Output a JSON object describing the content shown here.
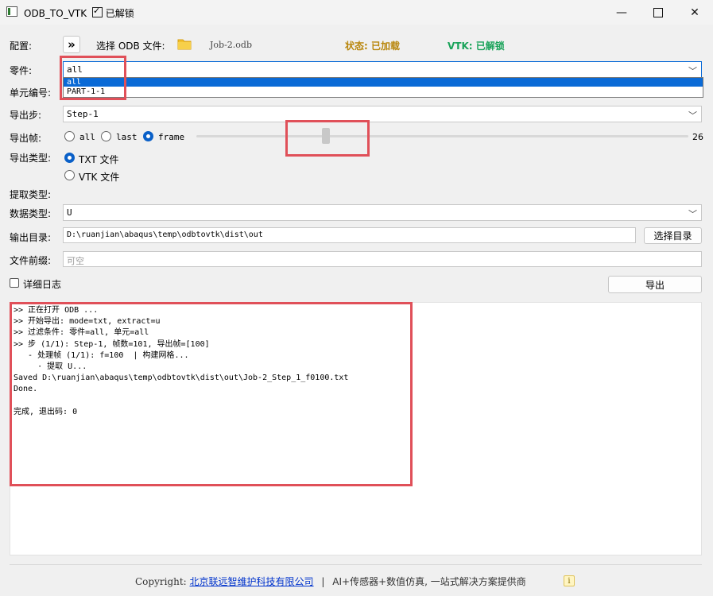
{
  "window": {
    "title": "ODB_TO_VTK",
    "title_status": "已解锁",
    "minimize_glyph": "—",
    "close_glyph": "✕"
  },
  "config": {
    "label": "配置:",
    "expand_glyph": "»",
    "select_odb_label": "选择 ODB 文件:",
    "file_name": "Job-2.odb",
    "status_text": "状态: 已加载",
    "vtk_text": "VTK: 已解锁"
  },
  "part": {
    "label": "零件:",
    "value": "all",
    "options": [
      "all",
      "PART-1-1"
    ]
  },
  "element": {
    "label": "单元编号:"
  },
  "step": {
    "label": "导出步:",
    "value": "Step-1"
  },
  "frame": {
    "label": "导出帧:",
    "options": [
      "all",
      "last",
      "frame"
    ],
    "selected": "frame",
    "slider_value": "26",
    "slider_fraction": 0.26
  },
  "export_type": {
    "label": "导出类型:",
    "options": [
      "TXT 文件",
      "VTK 文件"
    ],
    "selected": "TXT 文件"
  },
  "extract": {
    "label": "提取类型:"
  },
  "data_type": {
    "label": "数据类型:",
    "value": "U"
  },
  "output": {
    "label": "输出目录:",
    "path": "D:\\ruanjian\\abaqus\\temp\\odbtovtk\\dist\\out",
    "browse_label": "选择目录"
  },
  "prefix": {
    "label": "文件前缀:",
    "placeholder": "可空"
  },
  "verbose": {
    "label": "详细日志",
    "checked": false
  },
  "export_button": "导出",
  "log": {
    "lines": [
      ">> 正在打开 ODB ...",
      ">> 开始导出: mode=txt, extract=u",
      ">> 过滤条件: 零件=all, 单元=all",
      ">> 步 (1/1): Step-1, 帧数=101, 导出帧=[100]",
      "   - 处理帧 (1/1): f=100  | 构建网格...",
      "     · 提取 U...",
      "Saved D:\\ruanjian\\abaqus\\temp\\odbtovtk\\dist\\out\\Job-2_Step_1_f0100.txt",
      "Done.",
      "",
      "完成, 退出码: 0"
    ]
  },
  "footer": {
    "prefix": "Copyright:",
    "company": "北京联远智维护科技有限公司",
    "separator": "|",
    "tagline": "AI+传感器+数值仿真, 一站式解决方案提供商",
    "info_glyph": "i"
  },
  "colors": {
    "status": "#b8860b",
    "vtk": "#1aa35a",
    "selection": "#0a6ad6",
    "highlight_box": "#e05059",
    "link": "#0033cc"
  }
}
